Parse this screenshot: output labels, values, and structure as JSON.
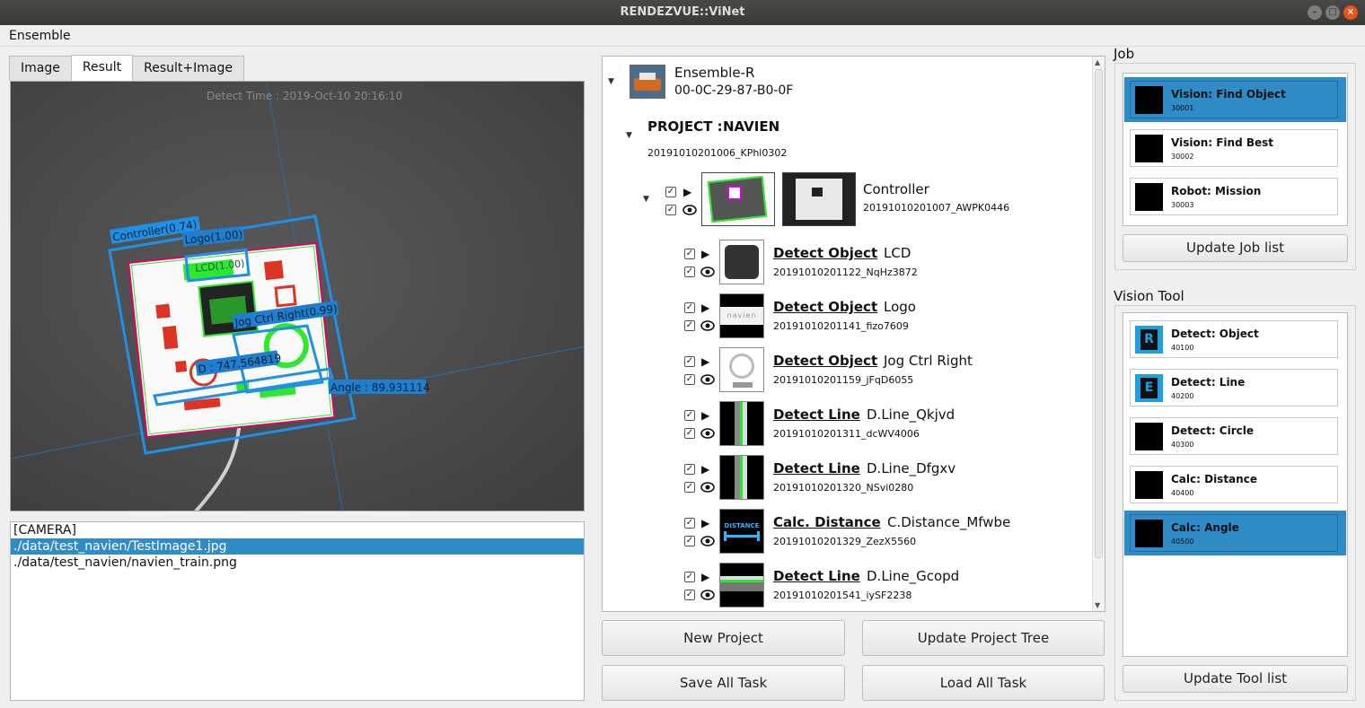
{
  "window": {
    "title": "RENDEZVUE::ViNet"
  },
  "menu": {
    "ensemble": "Ensemble"
  },
  "tabs": [
    "Image",
    "Result",
    "Result+Image"
  ],
  "viewer": {
    "detect_time": "Detect Time : 2019-Oct-10 20:16:10",
    "labels": {
      "controller": "Controller(0.74)",
      "logo": "Logo(1.00)",
      "lcd": "LCD(1.00)",
      "jog": "Jog Ctrl Right(0.99)",
      "distance": "D : 747.564819",
      "angle": "Angle : 89.931114"
    }
  },
  "files": [
    "[CAMERA]",
    "./data/test_navien/TestImage1.jpg",
    "./data/test_navien/navien_train.png"
  ],
  "tree": {
    "device_name": "Ensemble-R",
    "device_mac": "00-0C-29-87-B0-0F",
    "project_label": "PROJECT :",
    "project_name": "NAVIEN",
    "project_id": "20191010201006_KPhl0302",
    "controller_name": "Controller",
    "controller_id": "20191010201007_AWPK0446",
    "tasks": [
      {
        "type": "Detect Object",
        "name": "LCD",
        "id": "20191010201122_NqHz3872",
        "thumb": "lcd"
      },
      {
        "type": "Detect Object",
        "name": "Logo",
        "id": "20191010201141_fizo7609",
        "thumb": "logo"
      },
      {
        "type": "Detect Object",
        "name": "Jog Ctrl Right",
        "id": "20191010201159_jFqD6055",
        "thumb": "jog"
      },
      {
        "type": "Detect Line",
        "name": "D.Line_Qkjvd",
        "id": "20191010201311_dcWV4006",
        "thumb": "line"
      },
      {
        "type": "Detect Line",
        "name": "D.Line_Dfgxv",
        "id": "20191010201320_NSvi0280",
        "thumb": "line"
      },
      {
        "type": "Calc. Distance",
        "name": "C.Distance_Mfwbe",
        "id": "20191010201329_ZezX5560",
        "thumb": "distance"
      },
      {
        "type": "Detect Line",
        "name": "D.Line_Gcopd",
        "id": "20191010201541_iySF2238",
        "thumb": "hline"
      }
    ],
    "distance_thumb_text": "DISTANCE",
    "logo_thumb_text": "navien"
  },
  "buttons": {
    "new_project": "New Project",
    "update_project_tree": "Update Project Tree",
    "save_all_task": "Save All Task",
    "load_all_task": "Load All Task",
    "update_job_list": "Update Job list",
    "update_tool_list": "Update Tool list"
  },
  "job": {
    "title": "Job",
    "items": [
      {
        "title": "Vision: Find Object",
        "code": "30001",
        "selected": true
      },
      {
        "title": "Vision: Find Best",
        "code": "30002",
        "selected": false
      },
      {
        "title": "Robot: Mission",
        "code": "30003",
        "selected": false
      }
    ]
  },
  "vision_tool": {
    "title": "Vision Tool",
    "items": [
      {
        "title": "Detect: Object",
        "code": "40100",
        "icon_letter": "R",
        "selected": false
      },
      {
        "title": "Detect: Line",
        "code": "40200",
        "icon_letter": "E",
        "selected": false
      },
      {
        "title": "Detect: Circle",
        "code": "40300",
        "icon_letter": "",
        "selected": false
      },
      {
        "title": "Calc: Distance",
        "code": "40400",
        "icon_letter": "",
        "selected": false
      },
      {
        "title": "Calc: Angle",
        "code": "40500",
        "icon_letter": "",
        "selected": true
      }
    ]
  },
  "colors": {
    "selection": "#308cc6",
    "overlay_blue": "#1e90e6",
    "detect_green": "#2ee82e"
  }
}
